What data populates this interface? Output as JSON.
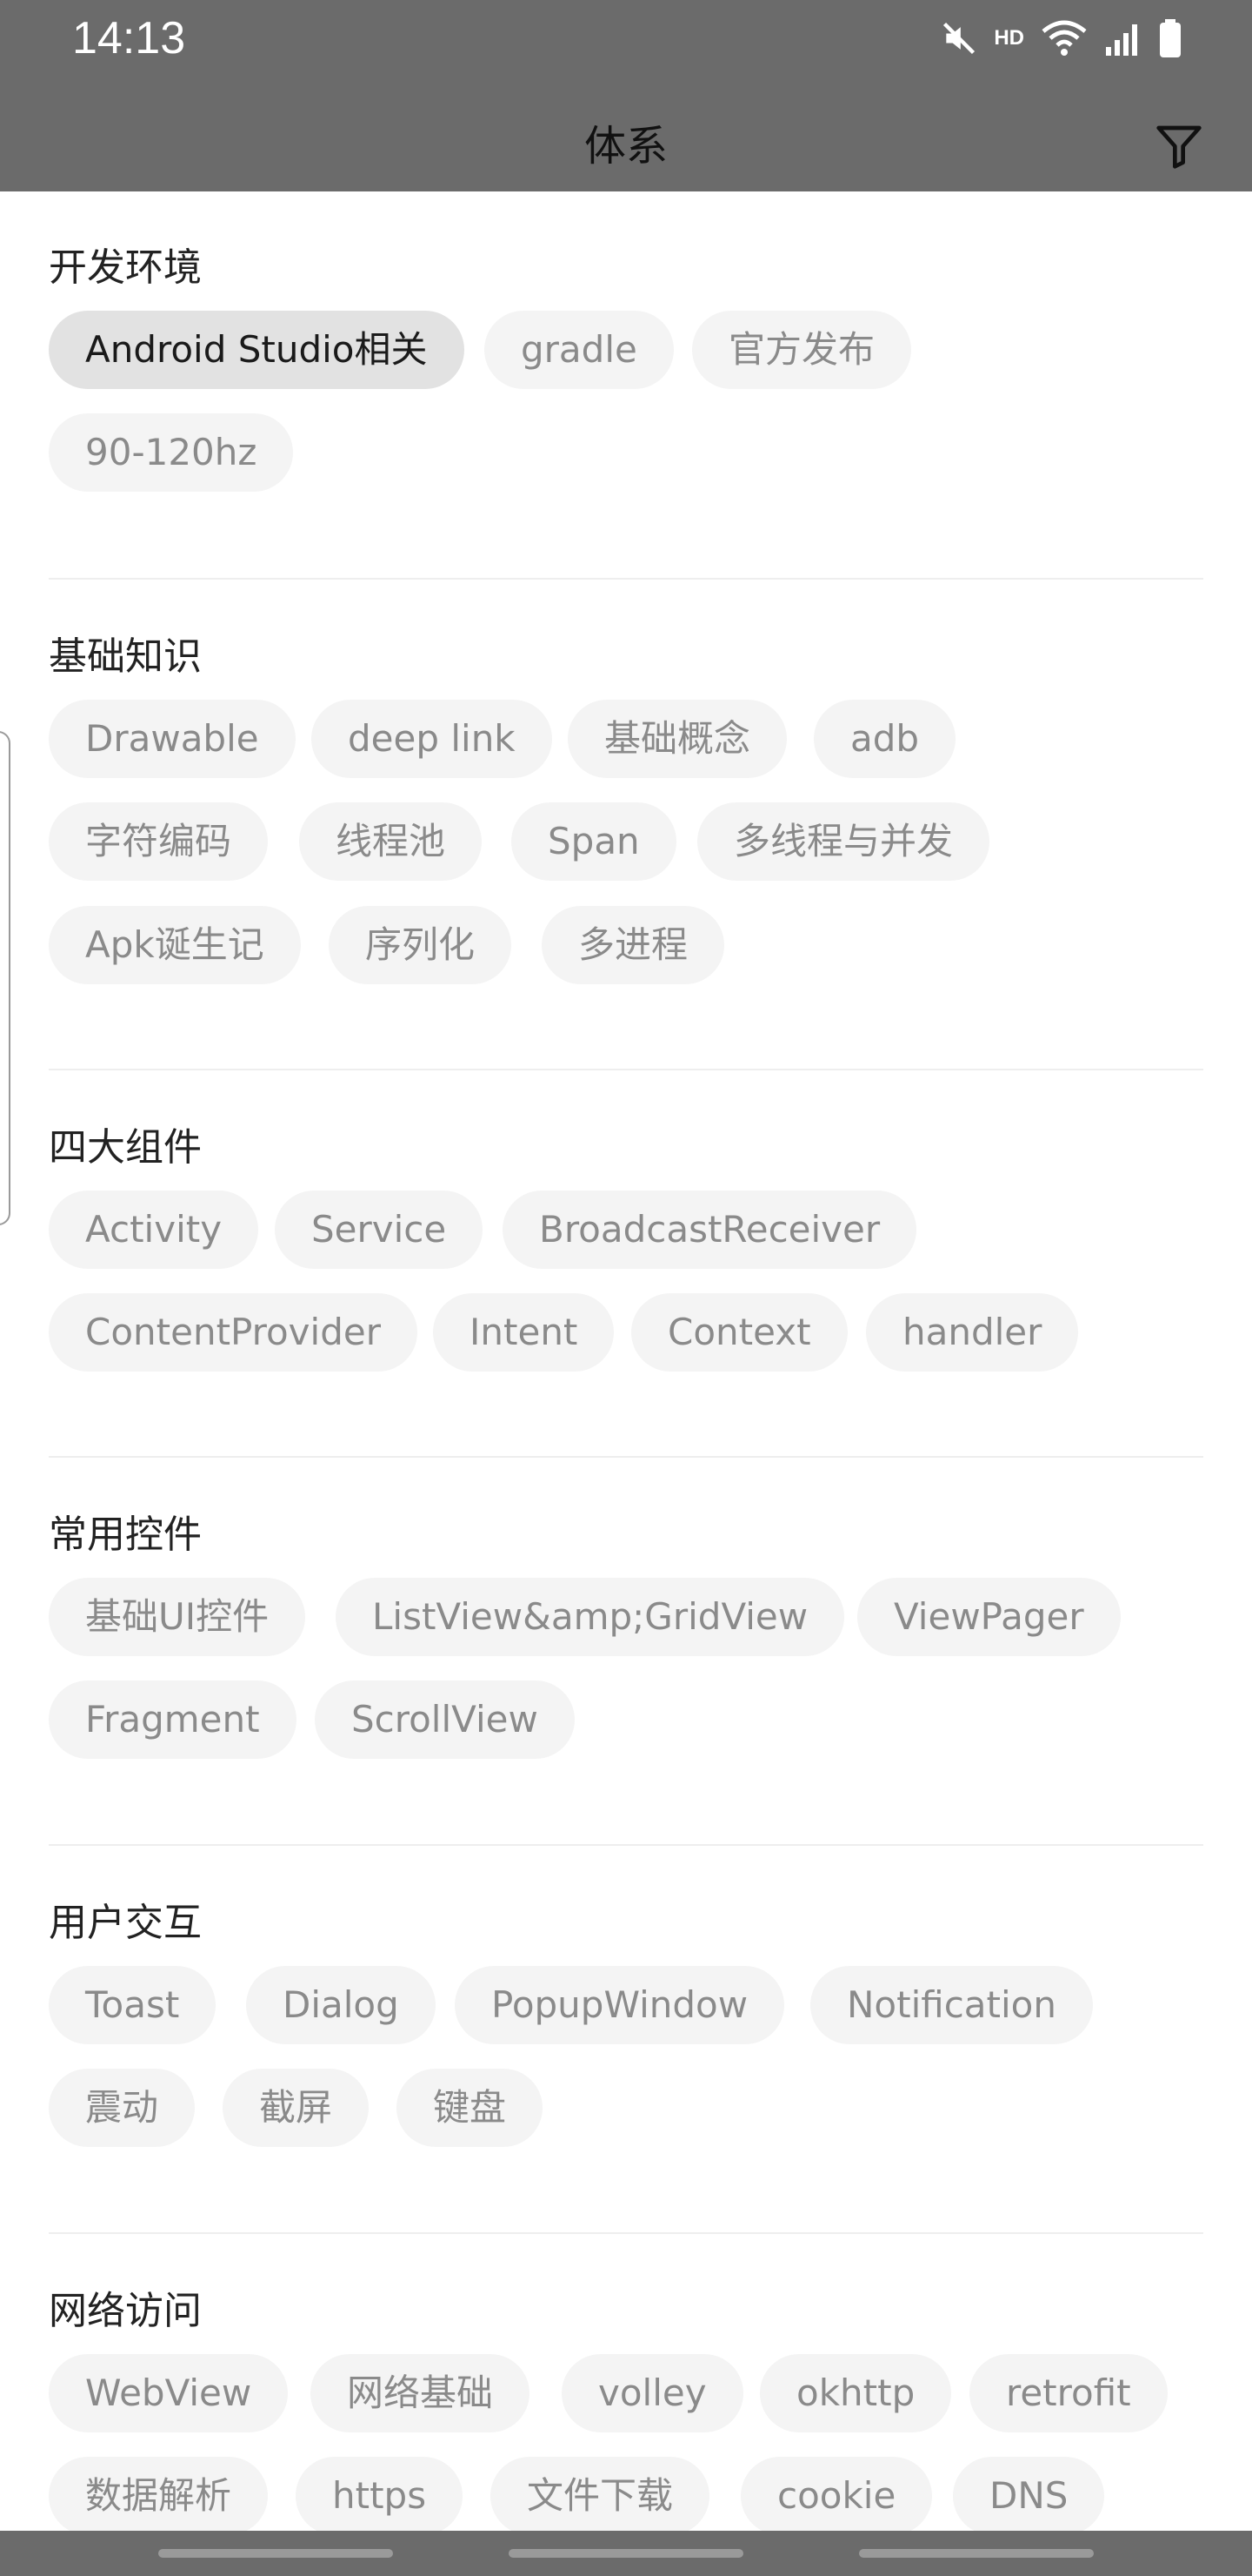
{
  "status_bar": {
    "time": "14:13",
    "hd_label": "HD",
    "icons": [
      "mute-icon",
      "wifi-icon",
      "signal-icon",
      "battery-icon"
    ]
  },
  "header": {
    "title": "体系",
    "filter_icon": "filter-icon"
  },
  "colors": {
    "header_bg": "#6b6b6b",
    "chip_bg": "#f4f4f4",
    "chip_selected_bg": "#e2e2e2",
    "chip_text": "#8a8a8a"
  },
  "sections": [
    {
      "title": "开发环境",
      "tags": [
        "Android Studio相关",
        "gradle",
        "官方发布",
        "90-120hz"
      ],
      "selected_index": 0
    },
    {
      "title": "基础知识",
      "tags": [
        "Drawable",
        "deep link",
        "基础概念",
        "adb",
        "字符编码",
        "线程池",
        "Span",
        "多线程与并发",
        "Apk诞生记",
        "序列化",
        "多进程"
      ]
    },
    {
      "title": "四大组件",
      "tags": [
        "Activity",
        "Service",
        "BroadcastReceiver",
        "ContentProvider",
        "Intent",
        "Context",
        "handler"
      ]
    },
    {
      "title": "常用控件",
      "tags": [
        "基础UI控件",
        "ListView&amp;GridView",
        "ViewPager",
        "Fragment",
        "ScrollView"
      ]
    },
    {
      "title": "用户交互",
      "tags": [
        "Toast",
        "Dialog",
        "PopupWindow",
        "Notification",
        "震动",
        "截屏",
        "键盘"
      ]
    },
    {
      "title": "网络访问",
      "tags": [
        "WebView",
        "网络基础",
        "volley",
        "okhttp",
        "retrofit",
        "数据解析",
        "https",
        "文件下载",
        "cookie",
        "DNS"
      ]
    }
  ]
}
